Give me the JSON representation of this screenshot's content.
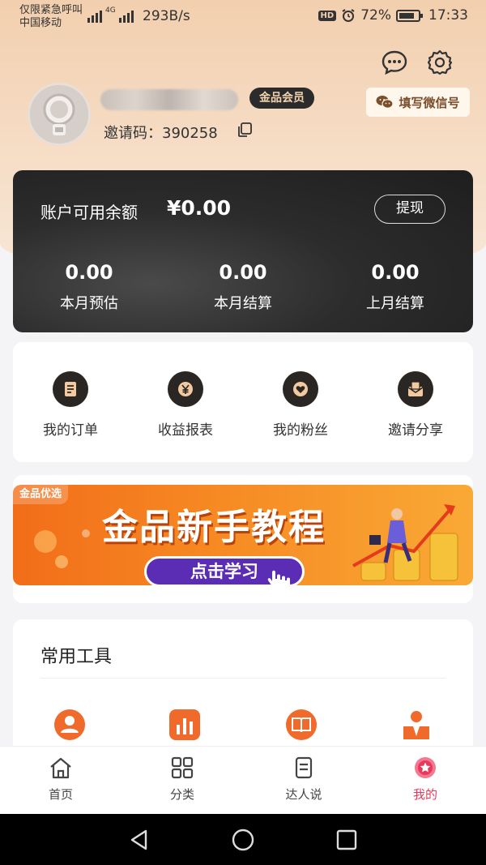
{
  "status_bar": {
    "carrier_line1": "仅限紧急呼叫",
    "carrier_line2": "中国移动",
    "network": "4G",
    "speed": "293B/s",
    "hd": "HD",
    "battery": "72%",
    "time": "17:33"
  },
  "header": {
    "wechat_button": "填写微信号",
    "vip_badge": "金品会员",
    "invite_label": "邀请码：",
    "invite_code": "390258"
  },
  "balance": {
    "label": "账户可用余额",
    "value": "¥0.00",
    "withdraw": "提现",
    "stats": [
      {
        "value": "0.00",
        "label": "本月预估"
      },
      {
        "value": "0.00",
        "label": "本月结算"
      },
      {
        "value": "0.00",
        "label": "上月结算"
      }
    ]
  },
  "quick_menu": [
    {
      "label": "我的订单",
      "icon": "order-icon"
    },
    {
      "label": "收益报表",
      "icon": "yuan-icon"
    },
    {
      "label": "我的粉丝",
      "icon": "heart-icon"
    },
    {
      "label": "邀请分享",
      "icon": "share-icon"
    }
  ],
  "banner": {
    "tag": "金品优选",
    "title": "金品新手教程",
    "cta": "点击学习"
  },
  "tools": {
    "title": "常用工具"
  },
  "tabbar": [
    {
      "label": "首页",
      "icon": "home-icon"
    },
    {
      "label": "分类",
      "icon": "grid-icon"
    },
    {
      "label": "达人说",
      "icon": "document-icon"
    },
    {
      "label": "我的",
      "icon": "profile-star-icon"
    }
  ],
  "colors": {
    "accent": "#e8385b",
    "banner": "#f68a23",
    "card_dark": "#2c2c2c"
  }
}
